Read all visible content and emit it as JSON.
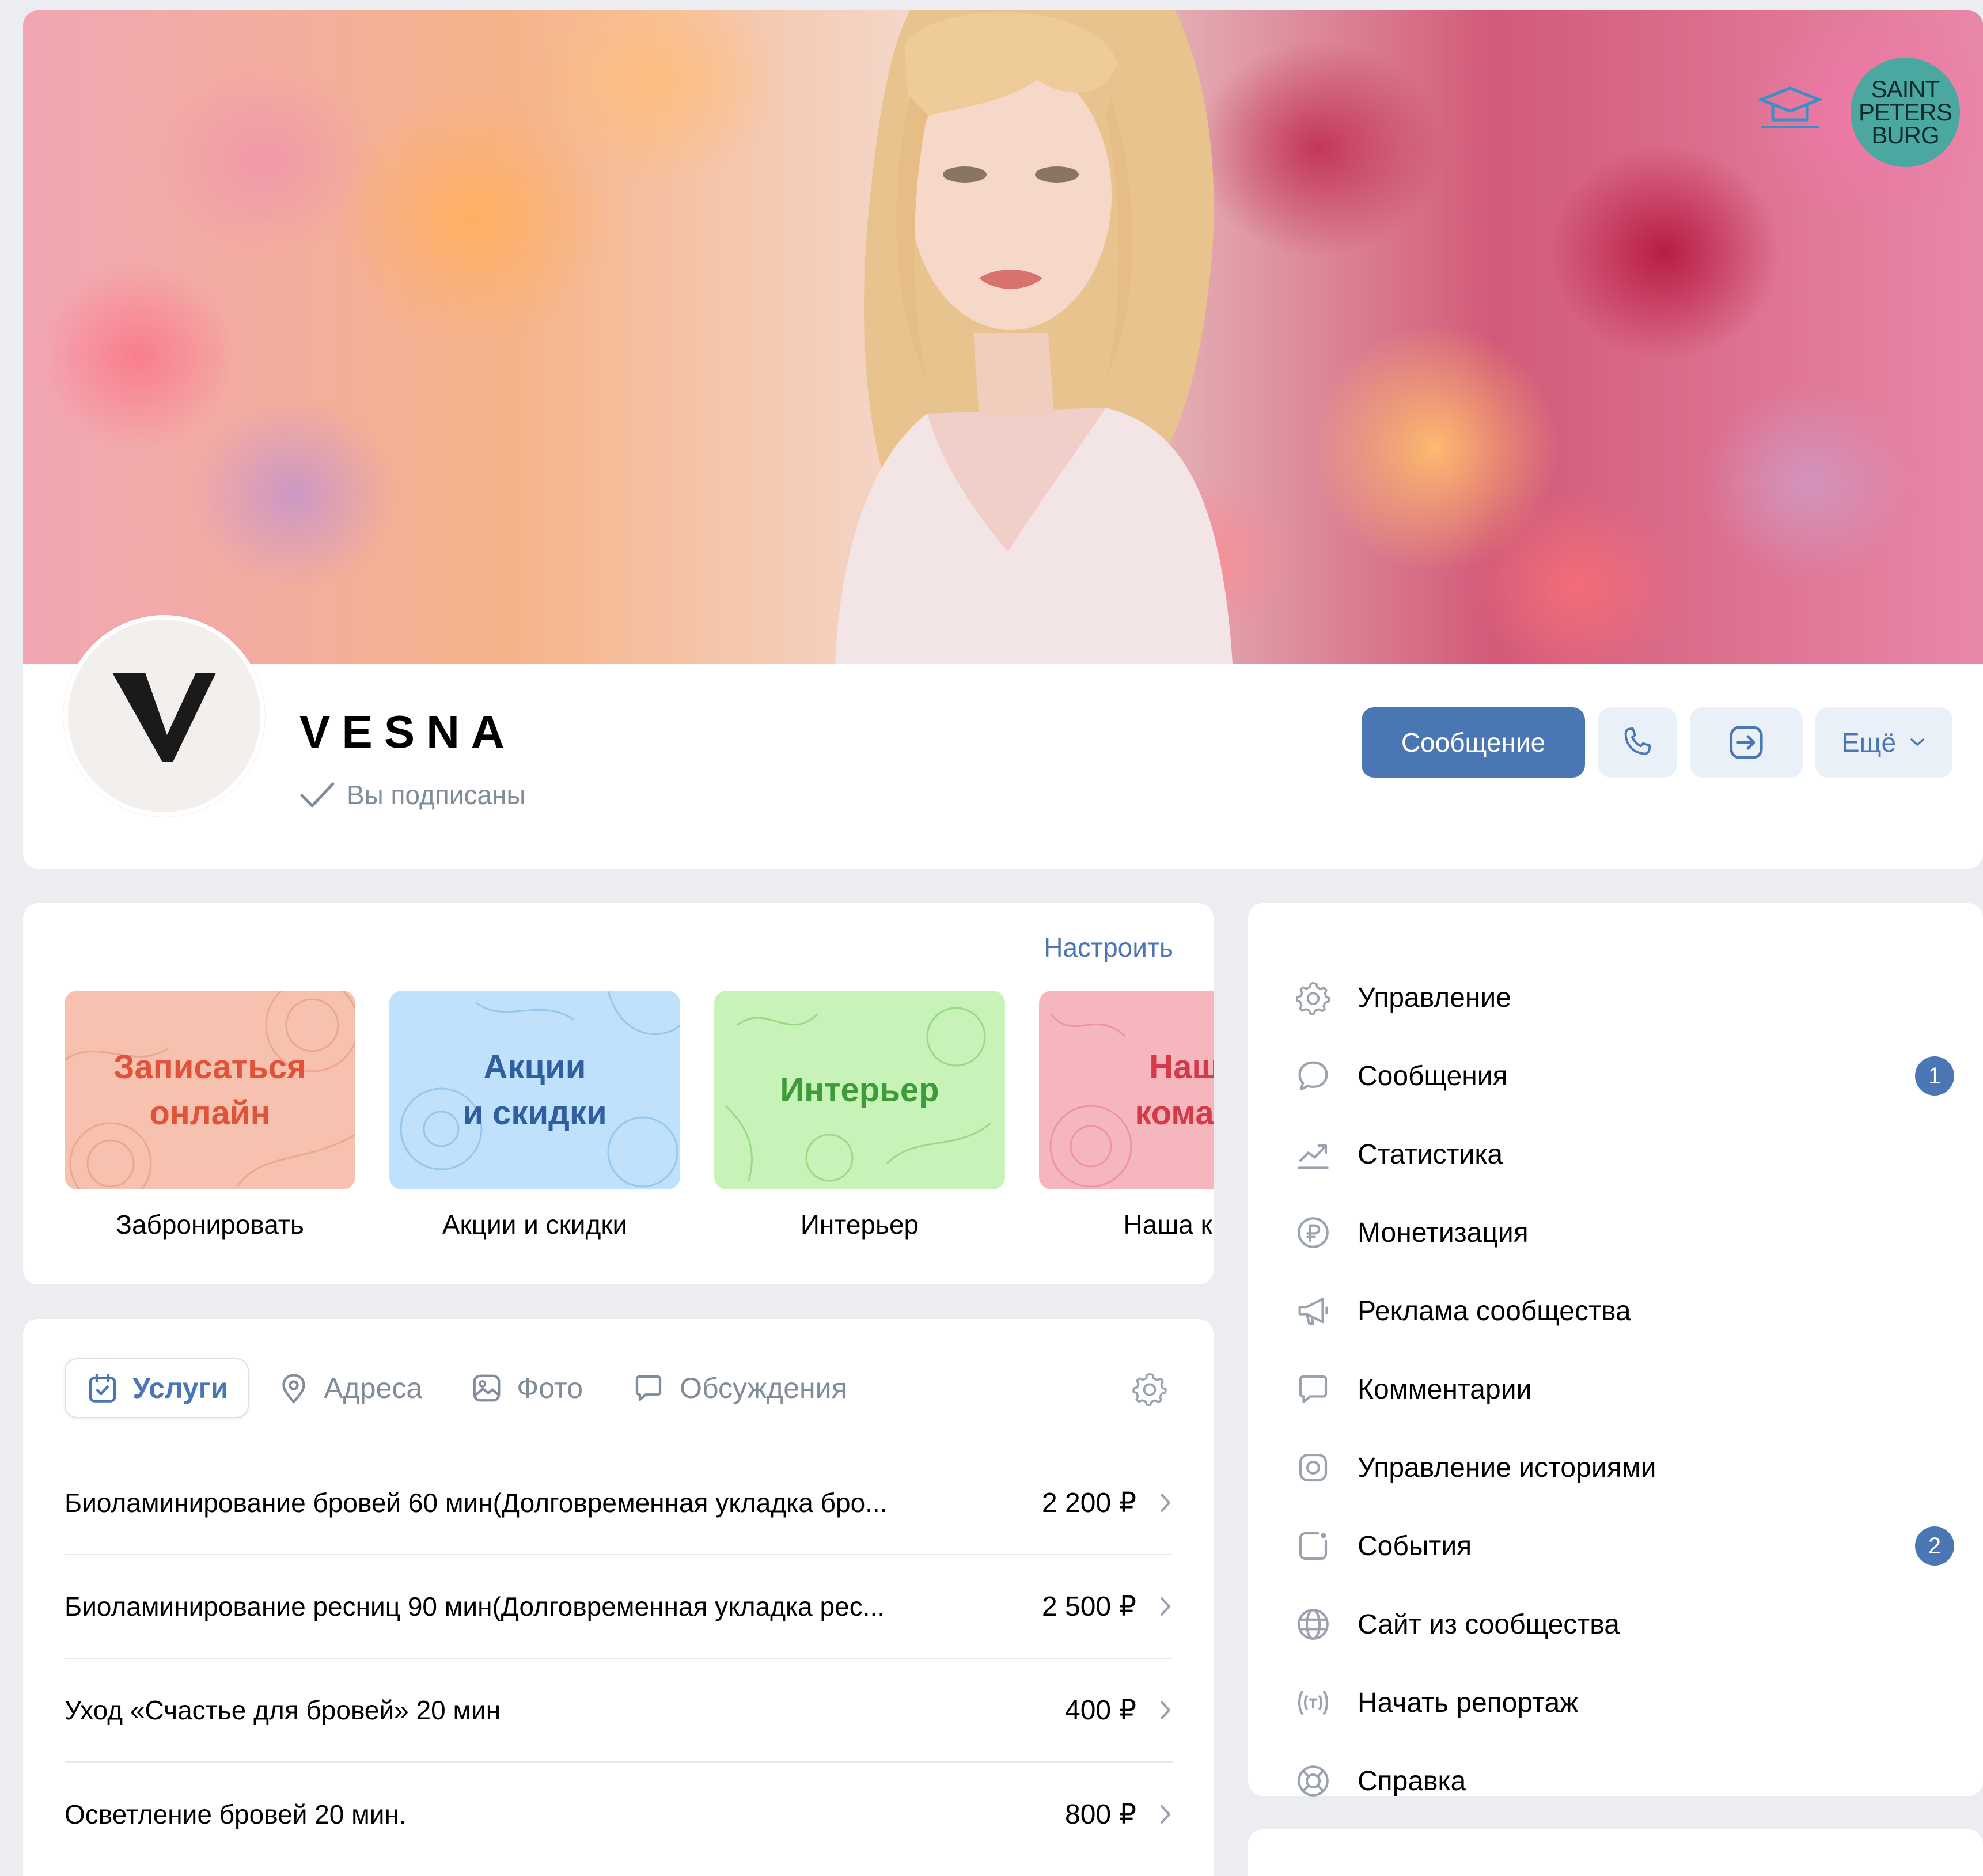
{
  "group": {
    "name": "VESNA",
    "avatar_letter": "V",
    "subscribed_text": "Вы подписаны"
  },
  "cover": {
    "badge_spb_lines": [
      "SAINT",
      "PETERS",
      "BURG"
    ]
  },
  "actions": {
    "message_label": "Сообщение",
    "call_icon": "phone-icon",
    "share_icon": "share-icon",
    "more_label": "Ещё"
  },
  "links": {
    "setup_label": "Настроить",
    "tiles": [
      {
        "image_text": "Записаться\nонлайн",
        "label": "Забронировать",
        "color": "#f6c1ae",
        "text_color": "#e0523a"
      },
      {
        "image_text": "Акции\nи скидки",
        "label": "Акции и скидки",
        "color": "#bfe1fb",
        "text_color": "#2f5f9e"
      },
      {
        "image_text": "Интерьер",
        "label": "Интерьер",
        "color": "#c7f3b8",
        "text_color": "#3f9a3a"
      },
      {
        "image_text": "Наш\nкоман",
        "label": "Наша ком",
        "color": "#f6b6be",
        "text_color": "#d43a4a"
      }
    ]
  },
  "tabs": [
    {
      "label": "Услуги",
      "icon": "calendar-check-icon",
      "active": true
    },
    {
      "label": "Адреса",
      "icon": "location-pin-icon",
      "active": false
    },
    {
      "label": "Фото",
      "icon": "photo-icon",
      "active": false
    },
    {
      "label": "Обсуждения",
      "icon": "chat-bubble-icon",
      "active": false
    }
  ],
  "services": [
    {
      "name": "Биоламинирование бровей 60 мин(Долговременная укладка бро...",
      "price": "2 200 ₽"
    },
    {
      "name": "Биоламинирование ресниц 90 мин(Долговременная укладка рес...",
      "price": "2 500 ₽"
    },
    {
      "name": "Уход «Счастье для бровей» 20 мин",
      "price": "400 ₽"
    },
    {
      "name": "Осветление бровей 20 мин.",
      "price": "800 ₽"
    }
  ],
  "menu": [
    {
      "label": "Управление",
      "icon": "gear-icon",
      "badge": null
    },
    {
      "label": "Сообщения",
      "icon": "message-bubble-icon",
      "badge": "1"
    },
    {
      "label": "Статистика",
      "icon": "stats-chart-icon",
      "badge": null
    },
    {
      "label": "Монетизация",
      "icon": "ruble-coin-icon",
      "badge": null
    },
    {
      "label": "Реклама сообщества",
      "icon": "megaphone-icon",
      "badge": null
    },
    {
      "label": "Комментарии",
      "icon": "comment-icon",
      "badge": null
    },
    {
      "label": "Управление историями",
      "icon": "stories-icon",
      "badge": null
    },
    {
      "label": "События",
      "icon": "event-icon",
      "badge": "2"
    },
    {
      "label": "Сайт из сообщества",
      "icon": "globe-icon",
      "badge": null
    },
    {
      "label": "Начать репортаж",
      "icon": "broadcast-icon",
      "badge": null
    },
    {
      "label": "Справка",
      "icon": "lifebuoy-icon",
      "badge": null
    }
  ],
  "colors": {
    "accent": "#4a76b4",
    "secondary_text": "#818c99",
    "page_bg": "#ebedf0"
  }
}
